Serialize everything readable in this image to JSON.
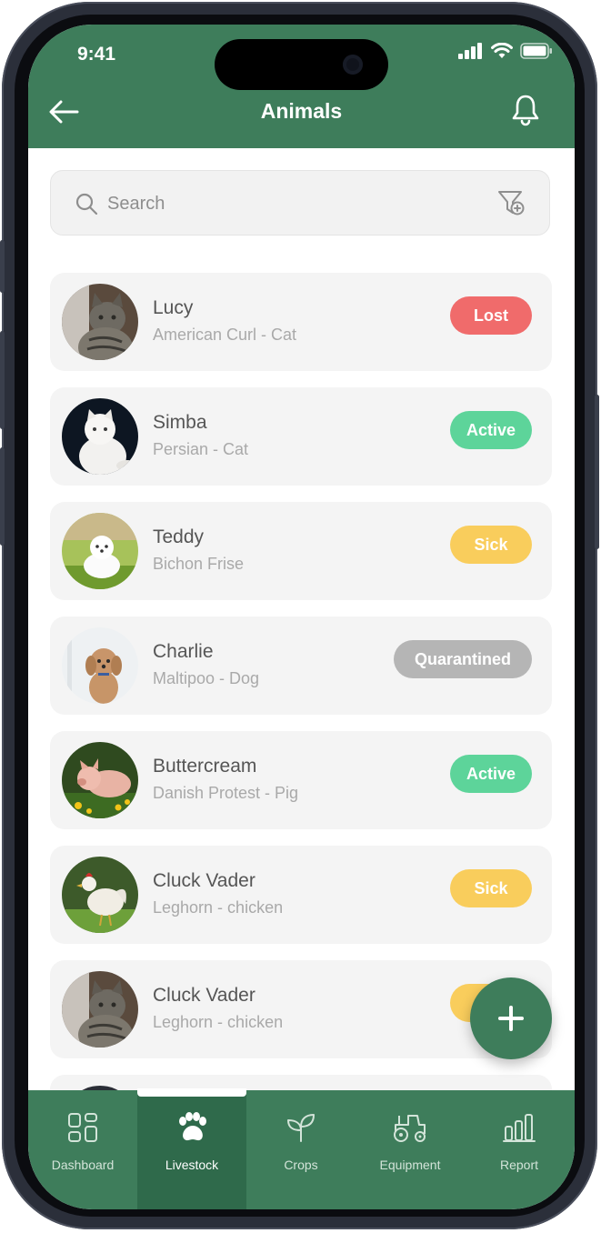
{
  "status_bar": {
    "time": "9:41"
  },
  "header": {
    "title": "Animals"
  },
  "search": {
    "placeholder": "Search",
    "value": ""
  },
  "animals": [
    {
      "name": "Lucy",
      "breed": "American Curl - Cat",
      "status": "Lost",
      "status_color": "#f06b6b"
    },
    {
      "name": "Simba",
      "breed": "Persian - Cat",
      "status": "Active",
      "status_color": "#5dd49a"
    },
    {
      "name": "Teddy",
      "breed": "Bichon Frise",
      "status": "Sick",
      "status_color": "#f9cd5c"
    },
    {
      "name": "Charlie",
      "breed": "Maltipoo - Dog",
      "status": "Quarantined",
      "status_color": "#b5b5b5"
    },
    {
      "name": "Buttercream",
      "breed": "Danish Protest - Pig",
      "status": "Active",
      "status_color": "#5dd49a"
    },
    {
      "name": "Cluck Vader",
      "breed": "Leghorn - chicken",
      "status": "Sick",
      "status_color": "#f9cd5c"
    },
    {
      "name": "Cluck Vader",
      "breed": "Leghorn - chicken",
      "status": "",
      "status_color": "#f9cd5c"
    }
  ],
  "tabs": [
    {
      "label": "Dashboard",
      "icon": "dashboard-grid-icon"
    },
    {
      "label": "Livestock",
      "icon": "paw-icon",
      "active": true
    },
    {
      "label": "Crops",
      "icon": "sprout-icon"
    },
    {
      "label": "Equipment",
      "icon": "tractor-icon"
    },
    {
      "label": "Report",
      "icon": "bar-chart-icon"
    }
  ],
  "colors": {
    "brand": "#3e7d5b",
    "brand_dark": "#2f6a4b"
  }
}
